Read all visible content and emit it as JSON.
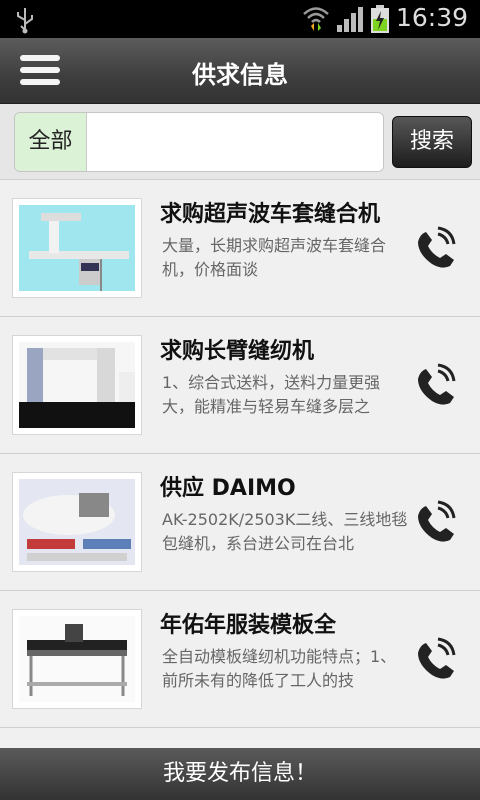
{
  "status": {
    "time": "16:39"
  },
  "header": {
    "title": "供求信息"
  },
  "search": {
    "category": "全部",
    "placeholder": "",
    "button": "搜索"
  },
  "items": [
    {
      "title": "求购超声波车套缝合机",
      "desc": "大量，长期求购超声波车套缝合机，价格面谈"
    },
    {
      "title": "求购长臂缝纫机",
      "desc": "1、综合式送料，送料力量更强大，能精准与轻易车缝多层之"
    },
    {
      "title": "供应 DAIMO",
      "desc": "AK-2502K/2503K二线、三线地毯包缝机，系台进公司在台北"
    },
    {
      "title": "年佑年服装模板全",
      "desc": "全自动模板缝纫机功能特点；1、前所未有的降低了工人的技"
    }
  ],
  "footer": {
    "publish": "我要发布信息！"
  }
}
